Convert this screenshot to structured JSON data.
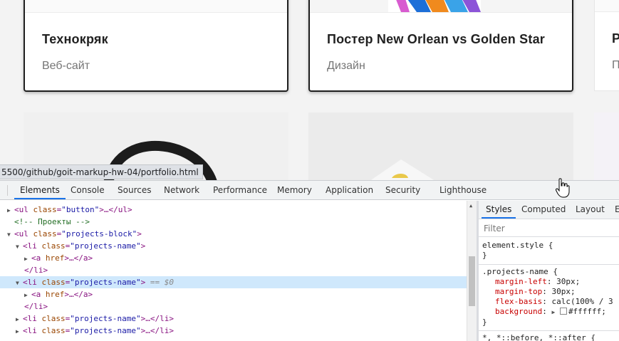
{
  "page": {
    "cards": [
      {
        "title": "Технокряк",
        "category": "Веб-сайт"
      },
      {
        "title": "Постер New Orlean vs Golden Star",
        "category": "Дизайн"
      },
      {
        "title": "Р",
        "category": "П"
      }
    ]
  },
  "url_tooltip": "5500/github/goit-markup-hw-04/portfolio.html",
  "devtools": {
    "tabs": [
      "Elements",
      "Console",
      "Sources",
      "Network",
      "Performance",
      "Memory",
      "Application",
      "Security",
      "Lighthouse"
    ],
    "active_tab": "Elements",
    "dom": {
      "l1": {
        "tri": "▶",
        "open": "<ul",
        "attr": "class",
        "val": "\"button\"",
        "rest": ">…</ul>"
      },
      "l2": {
        "comment": "<!-- Проекты -->"
      },
      "l3": {
        "tri": "▼",
        "open": "<ul",
        "attr": "class",
        "val": "\"projects-block\"",
        "rest": ">"
      },
      "l4": {
        "tri": "▼",
        "open": "<li",
        "attr": "class",
        "val": "\"projects-name\"",
        "rest": ">"
      },
      "l5": {
        "tri": "▶",
        "open": "<a",
        "attr": "href",
        "rest": ">…</a>"
      },
      "l6": {
        "close": "</li>"
      },
      "l7": {
        "tri": "▼",
        "open": "<li",
        "attr": "class",
        "val": "\"projects-name\"",
        "rest": ">",
        "marker": "== $0"
      },
      "l8": {
        "tri": "▶",
        "open": "<a",
        "attr": "href",
        "rest": ">…</a>"
      },
      "l9": {
        "close": "</li>"
      },
      "l10": {
        "tri": "▶",
        "open": "<li",
        "attr": "class",
        "val": "\"projects-name\"",
        "rest": ">…</li>"
      },
      "l11": {
        "tri": "▶",
        "open": "<li",
        "attr": "class",
        "val": "\"projects-name\"",
        "rest": ">…</li>"
      }
    },
    "styles": {
      "tabs": [
        "Styles",
        "Computed",
        "Layout",
        "E"
      ],
      "active_tab": "Styles",
      "filter_placeholder": "Filter",
      "element_style": "element.style {",
      "close_brace": "}",
      "rule_selector": ".projects-name {",
      "decls": [
        {
          "prop": "margin-left",
          "value": "30px;"
        },
        {
          "prop": "margin-top",
          "value": "30px;"
        },
        {
          "prop": "flex-basis",
          "value": "calc(100% / 3"
        },
        {
          "prop": "background",
          "value": "#ffffff;"
        }
      ],
      "next_rule": "*, *::before, *::after {"
    }
  }
}
